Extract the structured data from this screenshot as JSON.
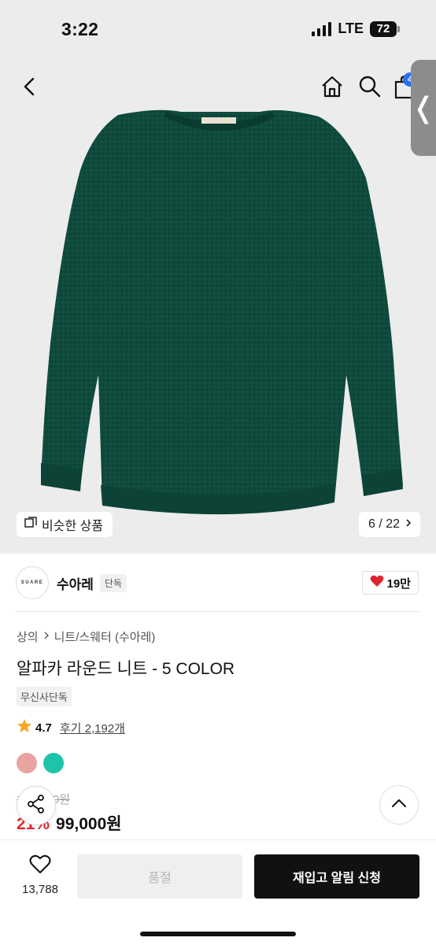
{
  "status_bar": {
    "time": "3:22",
    "network": "LTE",
    "battery": "72"
  },
  "header": {
    "icons": [
      "back-icon",
      "home-icon",
      "search-icon",
      "cart-icon"
    ],
    "cart_badge": "4"
  },
  "gallery": {
    "similar_label": "비슷한 상품",
    "page_counter": "6 / 22",
    "sweater_color": "#0f4a3c"
  },
  "brand": {
    "logo_text": "SUARE",
    "name": "수아레",
    "tag": "단독",
    "likes": "19만"
  },
  "product": {
    "breadcrumb": [
      "상의",
      "니트/스웨터 (수아레)"
    ],
    "title": "알파카 라운드 니트 - 5 COLOR",
    "exclusive_tag": "무신사단독",
    "rating": "4.7",
    "reviews": "후기 2,192개",
    "colors": [
      "#e9a3a0",
      "#1fc4a8"
    ],
    "original_price": "125,000원",
    "discount": "21%",
    "price": "99,000원"
  },
  "bottom_bar": {
    "wish_count": "13,788",
    "soldout_label": "품절",
    "restock_label": "재입고 알림 신청"
  },
  "colors": {
    "accent_red": "#e0242e",
    "badge_blue": "#2b6ff2",
    "dark": "#111111"
  }
}
